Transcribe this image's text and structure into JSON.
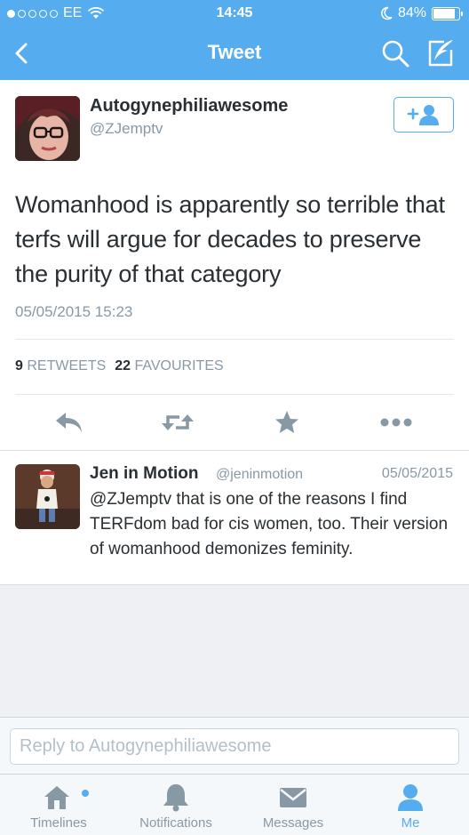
{
  "status_bar": {
    "carrier": "EE",
    "time": "14:45",
    "battery": "84%",
    "battery_level": 0.84
  },
  "nav": {
    "title": "Tweet"
  },
  "tweet": {
    "author_name": "Autogynephiliawesome",
    "author_handle": "@ZJemptv",
    "text": "Womanhood is apparently so terrible that terfs will argue for decades to preserve the purity of that category",
    "date": "05/05/2015 15:23",
    "retweet_count": "9",
    "retweet_label": "RETWEETS",
    "favourite_count": "22",
    "favourite_label": "FAVOURITES"
  },
  "reply": {
    "author_name": "Jen in Motion",
    "author_handle": "@jeninmotion",
    "date": "05/05/2015",
    "text": "@ZJemptv that is one of the reasons I find TERFdom bad for cis women, too. Their version of womanhood demonizes feminity."
  },
  "reply_box": {
    "placeholder": "Reply to Autogynephiliawesome"
  },
  "tabs": [
    {
      "label": "Timelines",
      "icon": "home-icon",
      "active": false
    },
    {
      "label": "Notifications",
      "icon": "bell-icon",
      "active": false
    },
    {
      "label": "Messages",
      "icon": "envelope-icon",
      "active": false
    },
    {
      "label": "Me",
      "icon": "person-icon",
      "active": true
    }
  ],
  "colors": {
    "accent": "#55acee",
    "muted": "#8899a6",
    "text": "#292f33"
  }
}
